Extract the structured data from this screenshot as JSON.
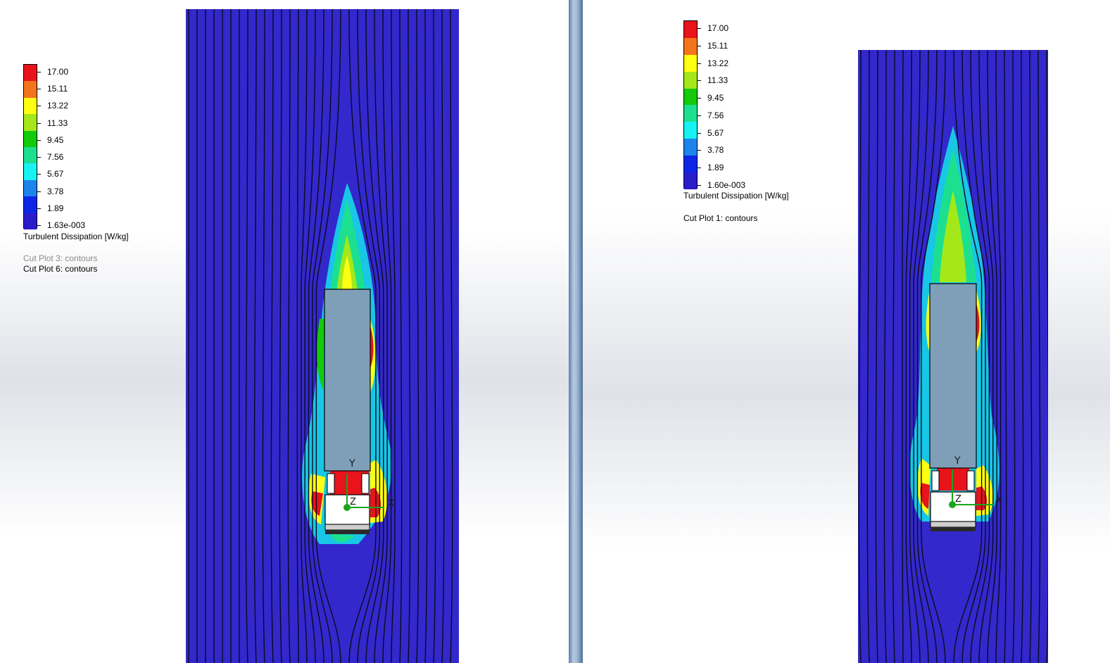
{
  "left": {
    "legend": {
      "colors": [
        "#e8131b",
        "#f4731d",
        "#ffff13",
        "#a4e81a",
        "#13ca0d",
        "#1ce08f",
        "#18f2f2",
        "#1c84ec",
        "#0d26e6",
        "#2b1cc9"
      ],
      "ticks": [
        "17.00",
        "15.11",
        "13.22",
        "11.33",
        "9.45",
        "7.56",
        "5.67",
        "3.78",
        "1.89",
        "1.63e-003"
      ],
      "title": "Turbulent Dissipation [W/kg]",
      "plots": [
        "Cut Plot 3: contours",
        "Cut Plot 6: contours"
      ]
    },
    "axes": {
      "y": "Y",
      "x": "X",
      "z": "Z"
    }
  },
  "right": {
    "legend": {
      "colors": [
        "#e8131b",
        "#f4731d",
        "#ffff13",
        "#a4e81a",
        "#13ca0d",
        "#1ce08f",
        "#18f2f2",
        "#1c84ec",
        "#0d26e6",
        "#2b1cc9"
      ],
      "ticks": [
        "17.00",
        "15.11",
        "13.22",
        "11.33",
        "9.45",
        "7.56",
        "5.67",
        "3.78",
        "1.89",
        "1.60e-003"
      ],
      "title": "Turbulent Dissipation [W/kg]",
      "plots": [
        "Cut Plot 1: contours"
      ]
    },
    "axes": {
      "y": "Y",
      "x": "X",
      "z": "Z"
    }
  },
  "colors": {
    "field": "#3228cc",
    "streamline": "#0a0a1e",
    "vehicle": "#7f9fb8",
    "axis": "#1aa51a"
  }
}
